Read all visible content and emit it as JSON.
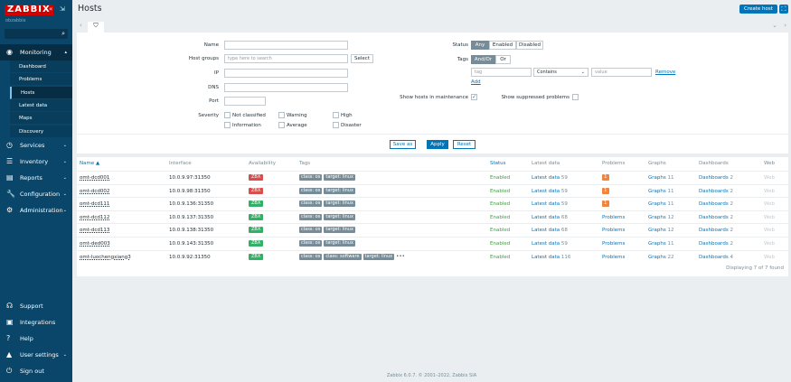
{
  "sidebar": {
    "logo": "ZABBIX",
    "user": "obzabbix",
    "menu": [
      {
        "label": "Monitoring",
        "icon": "eye-icon"
      },
      {
        "label": "Services",
        "icon": "clock-icon"
      },
      {
        "label": "Inventory",
        "icon": "list-icon"
      },
      {
        "label": "Reports",
        "icon": "chart-icon"
      },
      {
        "label": "Configuration",
        "icon": "wrench-icon"
      },
      {
        "label": "Administration",
        "icon": "gear-icon"
      }
    ],
    "monitoring_items": [
      "Dashboard",
      "Problems",
      "Hosts",
      "Latest data",
      "Maps",
      "Discovery"
    ],
    "bottom": [
      {
        "label": "Support",
        "icon": "headset-icon"
      },
      {
        "label": "Integrations",
        "icon": "integrations-icon"
      },
      {
        "label": "Help",
        "icon": "help-icon"
      },
      {
        "label": "User settings",
        "icon": "user-icon"
      },
      {
        "label": "Sign out",
        "icon": "power-icon"
      }
    ]
  },
  "header": {
    "title": "Hosts",
    "create": "Create host"
  },
  "filter": {
    "name_label": "Name",
    "groups_label": "Host groups",
    "groups_placeholder": "type here to search",
    "select": "Select",
    "ip_label": "IP",
    "dns_label": "DNS",
    "port_label": "Port",
    "severity_label": "Severity",
    "severities": [
      "Not classified",
      "Warning",
      "High",
      "Information",
      "Average",
      "Disaster"
    ],
    "status_label": "Status",
    "status_options": [
      "Any",
      "Enabled",
      "Disabled"
    ],
    "tags_label": "Tags",
    "tags_options": [
      "And/Or",
      "Or"
    ],
    "tag_placeholder": "tag",
    "operator": "Contains",
    "value_placeholder": "value",
    "remove": "Remove",
    "add": "Add",
    "maintenance": "Show hosts in maintenance",
    "maintenance_checked": true,
    "suppressed": "Show suppressed problems",
    "suppressed_checked": false,
    "save_as": "Save as",
    "apply": "Apply",
    "reset": "Reset"
  },
  "table": {
    "headers": [
      "Name ▲",
      "Interface",
      "Availability",
      "Tags",
      "Status",
      "Latest data",
      "Problems",
      "Graphs",
      "Dashboards",
      "Web"
    ],
    "rows": [
      {
        "name": "omt-dcd001",
        "iface": "10.0.9.97:31350",
        "avail": "ZBX",
        "avail_color": "#d64e4e",
        "tags": [
          "class: os",
          "target: linux"
        ],
        "status": "Enabled",
        "latest": "59",
        "problems": "1",
        "graphs": "11",
        "dash": "2",
        "web": "Web"
      },
      {
        "name": "omt-dcd002",
        "iface": "10.0.9.98:31350",
        "avail": "ZBX",
        "avail_color": "#d64e4e",
        "tags": [
          "class: os",
          "target: linux"
        ],
        "status": "Enabled",
        "latest": "59",
        "problems": "1",
        "graphs": "11",
        "dash": "2",
        "web": "Web"
      },
      {
        "name": "omt-dcd111",
        "iface": "10.0.9.136:31350",
        "avail": "ZBX",
        "avail_color": "#34af67",
        "tags": [
          "class: os",
          "target: linux"
        ],
        "status": "Enabled",
        "latest": "59",
        "problems": "1",
        "graphs": "11",
        "dash": "2",
        "web": "Web"
      },
      {
        "name": "omt-dcd112",
        "iface": "10.0.9.137:31350",
        "avail": "ZBX",
        "avail_color": "#34af67",
        "tags": [
          "class: os",
          "target: linux"
        ],
        "status": "Enabled",
        "latest": "68",
        "problems": "Problems",
        "graphs": "12",
        "dash": "2",
        "web": "Web"
      },
      {
        "name": "omt-dcd113",
        "iface": "10.0.9.138:31350",
        "avail": "ZBX",
        "avail_color": "#34af67",
        "tags": [
          "class: os",
          "target: linux"
        ],
        "status": "Enabled",
        "latest": "68",
        "problems": "Problems",
        "graphs": "12",
        "dash": "2",
        "web": "Web"
      },
      {
        "name": "omt-ded003",
        "iface": "10.0.9.143:31350",
        "avail": "ZBX",
        "avail_color": "#34af67",
        "tags": [
          "class: os",
          "target: linux"
        ],
        "status": "Enabled",
        "latest": "59",
        "problems": "Problems",
        "graphs": "11",
        "dash": "2",
        "web": "Web"
      },
      {
        "name": "omt-luochengxiang3",
        "iface": "10.0.9.92:31350",
        "avail": "ZBX",
        "avail_color": "#34af67",
        "tags": [
          "class: os",
          "class: software",
          "target: linux"
        ],
        "more": "•••",
        "status": "Enabled",
        "latest": "116",
        "problems": "Problems",
        "graphs": "22",
        "dash": "4",
        "web": "Web"
      }
    ],
    "latest_label": "Latest data",
    "graphs_label": "Graphs",
    "dash_label": "Dashboards",
    "footer": "Displaying 7 of 7 found"
  },
  "footer": "Zabbix 6.0.7. © 2001–2022, Zabbix SIA"
}
